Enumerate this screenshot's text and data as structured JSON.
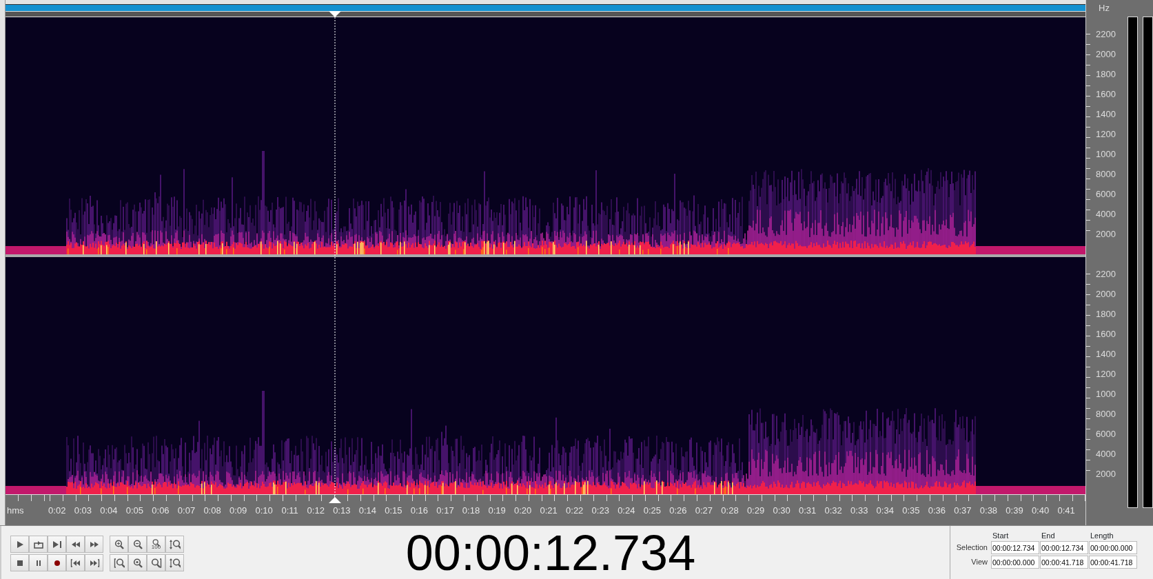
{
  "frequency_axis": {
    "unit": "Hz",
    "channels": [
      {
        "labels": [
          "2200",
          "2000",
          "1800",
          "1600",
          "1400",
          "1200",
          "1000",
          "8000",
          "6000",
          "4000",
          "2000"
        ]
      },
      {
        "labels": [
          "2200",
          "2000",
          "1800",
          "1600",
          "1400",
          "1200",
          "1000",
          "8000",
          "6000",
          "4000",
          "2000"
        ]
      }
    ]
  },
  "playhead": {
    "level": 0.3052
  },
  "timeline": {
    "unit": "hms",
    "labels": [
      "0:02",
      "0:03",
      "0:04",
      "0:05",
      "0:06",
      "0:07",
      "0:08",
      "0:09",
      "0:10",
      "0:11",
      "0:12",
      "0:13",
      "0:14",
      "0:15",
      "0:16",
      "0:17",
      "0:18",
      "0:19",
      "0:20",
      "0:21",
      "0:22",
      "0:23",
      "0:24",
      "0:25",
      "0:26",
      "0:27",
      "0:28",
      "0:29",
      "0:30",
      "0:31",
      "0:32",
      "0:33",
      "0:34",
      "0:35",
      "0:36",
      "0:37",
      "0:38",
      "0:39",
      "0:40",
      "0:41"
    ]
  },
  "transport_buttons": [
    [
      {
        "kind": "play"
      },
      {
        "kind": "loop"
      },
      {
        "kind": "play-to-end"
      },
      {
        "kind": "rewind"
      },
      {
        "kind": "fast-forward"
      }
    ],
    [
      {
        "kind": "stop"
      },
      {
        "kind": "pause"
      },
      {
        "kind": "record"
      },
      {
        "kind": "go-to-start"
      },
      {
        "kind": "go-to-end"
      }
    ]
  ],
  "zoom_buttons": [
    [
      {
        "kind": "zoom-in"
      },
      {
        "kind": "zoom-out"
      },
      {
        "kind": "zoom-reset",
        "label": "100"
      },
      {
        "kind": "zoom-vertical"
      }
    ],
    [
      {
        "kind": "zoom-left"
      },
      {
        "kind": "zoom-center"
      },
      {
        "kind": "zoom-right"
      },
      {
        "kind": "zoom-vertical"
      }
    ]
  ],
  "time_display": "00:00:12.734",
  "selection_panel": {
    "columns": [
      "Start",
      "End",
      "Length"
    ],
    "rows": [
      {
        "label": "Selection",
        "values": [
          "00:00:12.734",
          "00:00:12.734",
          "00:00:00.000"
        ]
      },
      {
        "label": "View",
        "values": [
          "00:00:00.000",
          "00:00:41.718",
          "00:00:41.718"
        ]
      }
    ]
  }
}
